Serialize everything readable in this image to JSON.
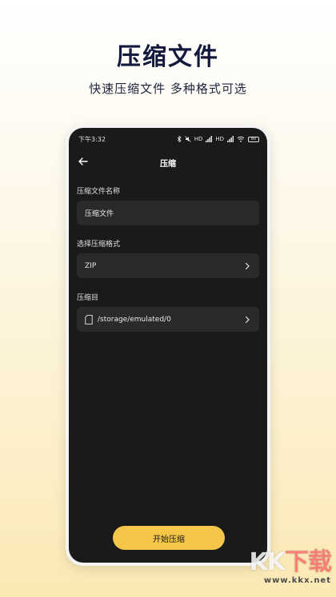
{
  "promo": {
    "title": "压缩文件",
    "subtitle": "快速压缩文件  多种格式可选"
  },
  "status_bar": {
    "time": "下午3:32",
    "signal1": "HD",
    "signal2": "HD",
    "battery": "80"
  },
  "header": {
    "title": "压缩"
  },
  "form": {
    "name_label": "压缩文件名称",
    "name_value": "压缩文件",
    "format_label": "选择压缩格式",
    "format_value": "ZIP",
    "dir_label": "压缩目",
    "dir_value": "/storage/emulated/0"
  },
  "actions": {
    "start_label": "开始压缩"
  },
  "watermark": {
    "logo_k1": "K",
    "logo_k2": "K",
    "logo_xia": "下载",
    "url": "www.kkx.net"
  },
  "colors": {
    "accent": "#f5c64a",
    "screen_bg": "#1a1a1a",
    "field_bg": "#2a2a2a"
  }
}
